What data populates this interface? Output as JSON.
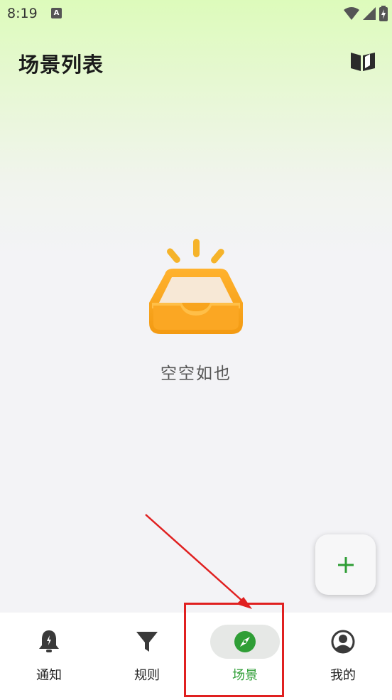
{
  "status_bar": {
    "time": "8:19",
    "notification_letter": "A"
  },
  "header": {
    "title": "场景列表",
    "action_icon": "book-icon"
  },
  "empty_state": {
    "text": "空空如也",
    "icon": "empty-inbox-illustration"
  },
  "fab": {
    "icon": "plus-icon"
  },
  "bottom_nav": {
    "active_index": 2,
    "items": [
      {
        "label": "通知",
        "icon": "bell-icon"
      },
      {
        "label": "规则",
        "icon": "filter-icon"
      },
      {
        "label": "场景",
        "icon": "compass-icon"
      },
      {
        "label": "我的",
        "icon": "account-icon"
      }
    ]
  },
  "colors": {
    "accent_green": "#2f9e36",
    "annotation_red": "#e02020"
  }
}
